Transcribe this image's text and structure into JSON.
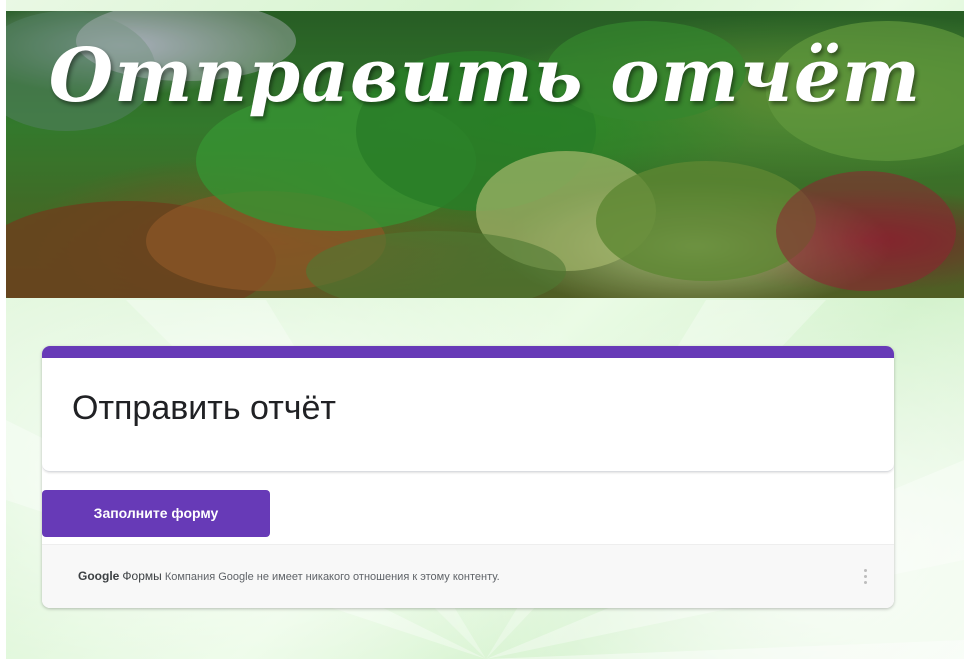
{
  "header": {
    "banner_title": "Отправить отчёт"
  },
  "form": {
    "title": "Отправить отчёт",
    "fill_button_label": "Заполните форму",
    "accent_color": "#673ab7"
  },
  "footer": {
    "brand": "Google",
    "product": "Формы",
    "disclaimer": "Компания Google не имеет никакого отношения к этому контенту.",
    "more_icon": "more-vert-icon"
  }
}
